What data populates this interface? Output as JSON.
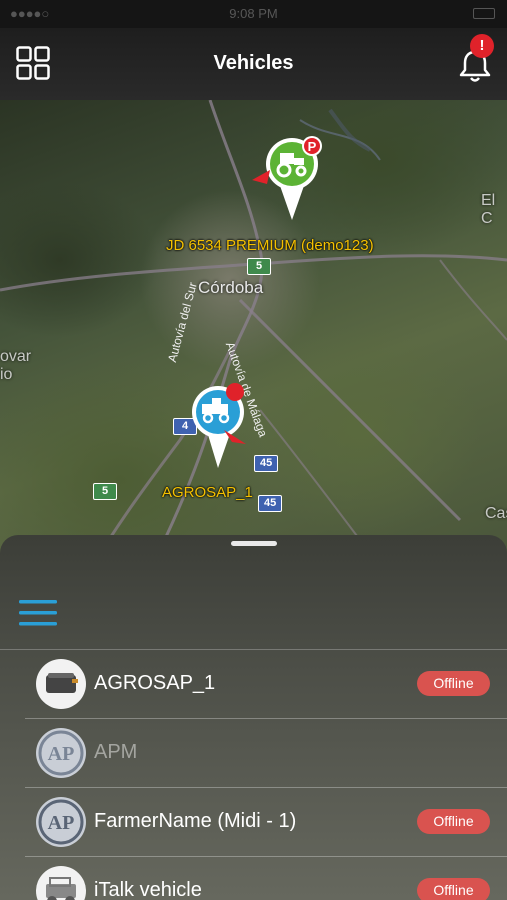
{
  "status_bar": {
    "carrier": "●●●●○ ",
    "time": "9:08 PM"
  },
  "header": {
    "title": "Vehicles",
    "notification_badge": "!"
  },
  "map": {
    "city": "Córdoba",
    "roads": [
      {
        "label": "5",
        "type": "green"
      },
      {
        "label": "4",
        "type": "blue"
      },
      {
        "label": "45",
        "type": "blue"
      },
      {
        "label": "5",
        "type": "green"
      },
      {
        "label": "45",
        "type": "blue"
      }
    ],
    "street_labels": [
      "Autovía del Sur",
      "Autovía de Málaga"
    ],
    "edge_labels": [
      "El C",
      "ovar",
      "io",
      "Cas"
    ],
    "vehicles": [
      {
        "label": "JD 6534 PREMIUM (demo123)",
        "marker_color": "#5cb335",
        "badge": "P",
        "icon": "tractor-icon"
      },
      {
        "label": "AGROSAP_1",
        "marker_color": "#2a9fd6",
        "badge": "",
        "icon": "harvester-icon"
      }
    ]
  },
  "list": {
    "items": [
      {
        "name": "AGROSAP_1",
        "status": "Offline",
        "avatar": "gps-device-avatar",
        "muted": false
      },
      {
        "name": "APM",
        "status": "",
        "avatar": "ap-logo-avatar",
        "muted": true
      },
      {
        "name": "FarmerName (Midi - 1)",
        "status": "Offline",
        "avatar": "ap-logo-avatar",
        "muted": false
      },
      {
        "name": "iTalk vehicle",
        "status": "Offline",
        "avatar": "utv-avatar",
        "muted": false
      }
    ]
  },
  "colors": {
    "offline": "#d9534f",
    "accent_blue": "#2a9fd6",
    "badge_red": "#e0222a"
  }
}
